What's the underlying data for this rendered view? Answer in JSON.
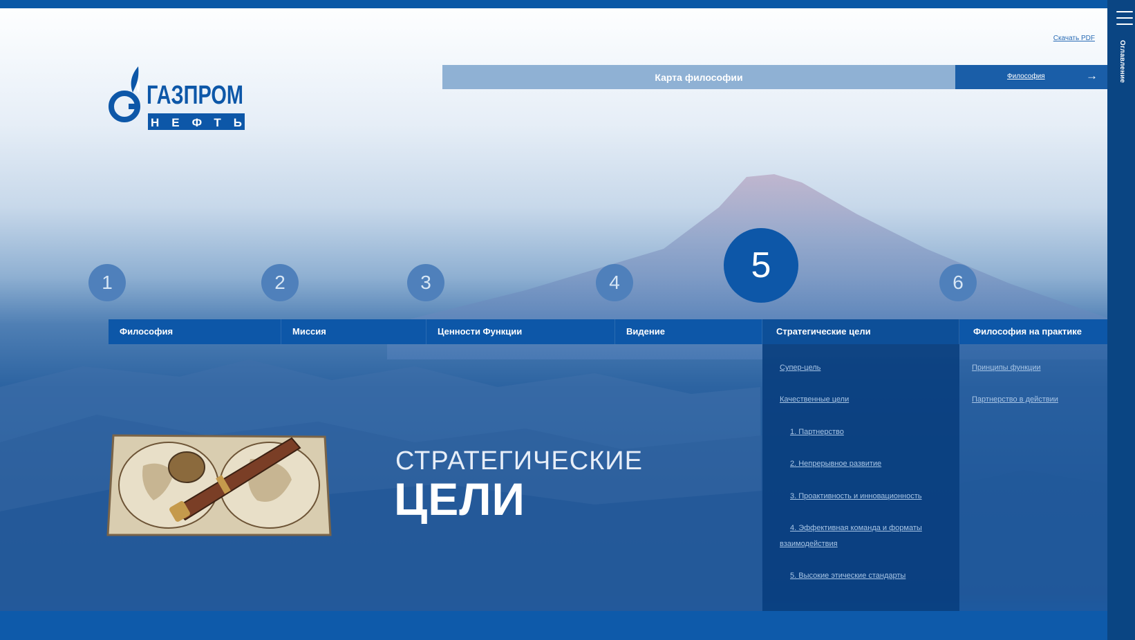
{
  "header": {
    "download_label": "Скачать PDF",
    "map_title": "Карта философии",
    "nav_label": "Философия"
  },
  "logo": {
    "line1": "ГАЗПРОМ",
    "line2": "НЕФТЬ"
  },
  "sidebar": {
    "label": "Оглавление"
  },
  "steps": [
    "1",
    "2",
    "3",
    "4",
    "5",
    "6"
  ],
  "active_step": "5",
  "tabs": [
    "Философия",
    "Миссия",
    "Ценности Функции",
    "Видение",
    "Стратегические цели",
    "Философия на практике"
  ],
  "goals_links": [
    "Супер-цель",
    "Качественные цели",
    "1. Партнерство",
    "2. Непрерывное развитие",
    "3. Проактивность и инновационность",
    "4. Эффективная команда и форматы",
    "взаимодействия",
    "5. Высокие этические стандарты"
  ],
  "practice_links": [
    "Принципы функции",
    "Партнерство в действии"
  ],
  "page_title": {
    "light": "СТРАТЕГИЧЕСКИЕ",
    "bold": "ЦЕЛИ"
  },
  "colors": {
    "brand_blue": "#0d57a8",
    "accent_light": "#8fb1d4",
    "sidebar": "#0a4583"
  }
}
